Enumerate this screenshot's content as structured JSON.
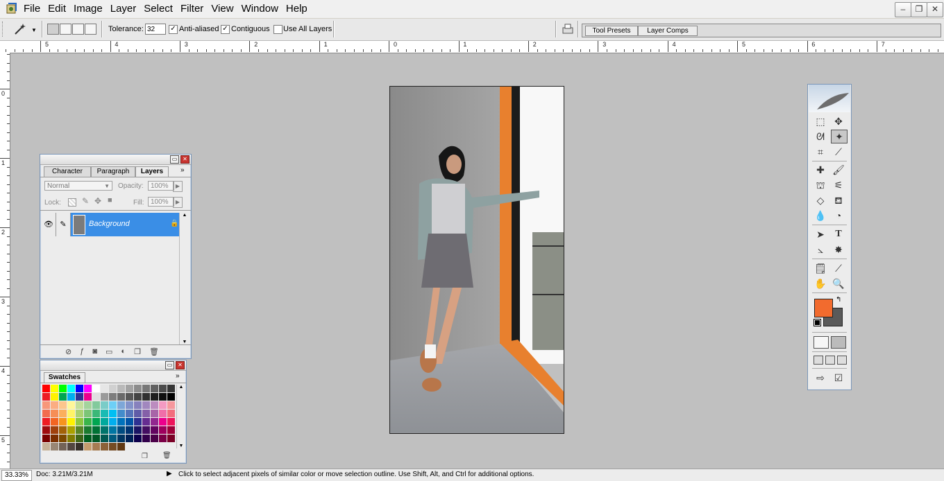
{
  "menu": {
    "items": [
      "File",
      "Edit",
      "Image",
      "Layer",
      "Select",
      "Filter",
      "View",
      "Window",
      "Help"
    ]
  },
  "window_controls": {
    "minimize": "–",
    "restore": "❐",
    "close": "✕"
  },
  "options": {
    "tolerance_label": "Tolerance:",
    "tolerance_value": "32",
    "anti_aliased_label": "Anti-aliased",
    "anti_aliased_checked": true,
    "contiguous_label": "Contiguous",
    "contiguous_checked": true,
    "use_all_layers_label": "Use All Layers",
    "use_all_layers_checked": false,
    "tabs": [
      "Tool Presets",
      "Layer Comps"
    ]
  },
  "ruler": {
    "horizontal": [
      "5",
      "4",
      "3",
      "2",
      "1",
      "0",
      "1",
      "2",
      "3",
      "4",
      "5",
      "6",
      "7"
    ],
    "vertical": [
      "0",
      "1",
      "2",
      "3",
      "4",
      "5"
    ]
  },
  "layers_panel": {
    "tabs": [
      "Character",
      "Paragraph",
      "Layers"
    ],
    "active_tab": "Layers",
    "blend_mode": "Normal",
    "opacity_label": "Opacity:",
    "opacity_value": "100%",
    "lock_label": "Lock:",
    "fill_label": "Fill:",
    "fill_value": "100%",
    "layer_name": "Background",
    "highlight_color": "#3a8ee6"
  },
  "swatches_panel": {
    "tab": "Swatches"
  },
  "toolbox": {
    "foreground_color": "#f26b2e",
    "background_color": "#5a5a5a",
    "type_tool_glyph": "T"
  },
  "status": {
    "zoom": "33.33%",
    "doc": "Doc: 3.21M/3.21M",
    "hint": "Click to select adjacent pixels of similar color or move selection outline.  Use Shift, Alt, and Ctrl for additional options."
  }
}
